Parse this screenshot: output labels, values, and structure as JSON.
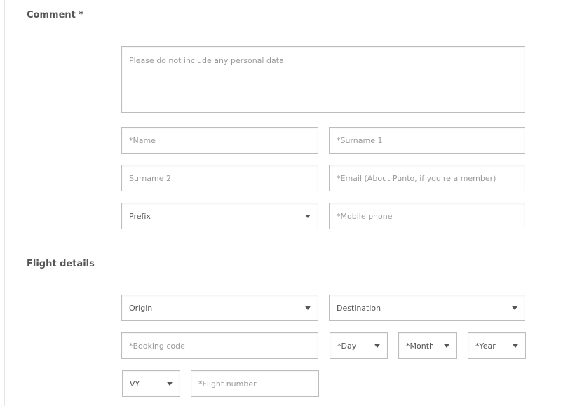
{
  "comment_section": {
    "title": "Comment *",
    "comment_placeholder": "Please do not include any personal data.",
    "name_placeholder": "*Name",
    "surname1_placeholder": "*Surname 1",
    "surname2_placeholder": "Surname 2",
    "email_placeholder": "*Email (About Punto, if you're a member)",
    "prefix_select": "Prefix",
    "mobile_placeholder": "*Mobile phone"
  },
  "flight_section": {
    "title": "Flight details",
    "origin_select": "Origin",
    "destination_select": "Destination",
    "booking_placeholder": "*Booking code",
    "day_select": "*Day",
    "month_select": "*Month",
    "year_select": "*Year",
    "airline_select": "VY",
    "flight_number_placeholder": "*Flight number"
  },
  "icons": {
    "dropdown": "chevron-down-icon"
  }
}
